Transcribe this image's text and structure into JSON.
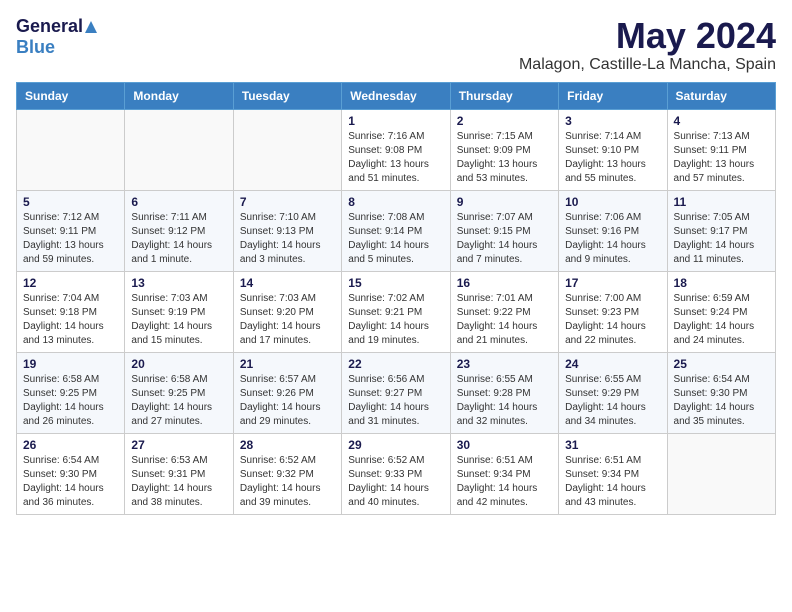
{
  "header": {
    "logo_general": "General",
    "logo_blue": "Blue",
    "month": "May 2024",
    "location": "Malagon, Castille-La Mancha, Spain"
  },
  "weekdays": [
    "Sunday",
    "Monday",
    "Tuesday",
    "Wednesday",
    "Thursday",
    "Friday",
    "Saturday"
  ],
  "weeks": [
    [
      {
        "day": "",
        "info": ""
      },
      {
        "day": "",
        "info": ""
      },
      {
        "day": "",
        "info": ""
      },
      {
        "day": "1",
        "info": "Sunrise: 7:16 AM\nSunset: 9:08 PM\nDaylight: 13 hours\nand 51 minutes."
      },
      {
        "day": "2",
        "info": "Sunrise: 7:15 AM\nSunset: 9:09 PM\nDaylight: 13 hours\nand 53 minutes."
      },
      {
        "day": "3",
        "info": "Sunrise: 7:14 AM\nSunset: 9:10 PM\nDaylight: 13 hours\nand 55 minutes."
      },
      {
        "day": "4",
        "info": "Sunrise: 7:13 AM\nSunset: 9:11 PM\nDaylight: 13 hours\nand 57 minutes."
      }
    ],
    [
      {
        "day": "5",
        "info": "Sunrise: 7:12 AM\nSunset: 9:11 PM\nDaylight: 13 hours\nand 59 minutes."
      },
      {
        "day": "6",
        "info": "Sunrise: 7:11 AM\nSunset: 9:12 PM\nDaylight: 14 hours\nand 1 minute."
      },
      {
        "day": "7",
        "info": "Sunrise: 7:10 AM\nSunset: 9:13 PM\nDaylight: 14 hours\nand 3 minutes."
      },
      {
        "day": "8",
        "info": "Sunrise: 7:08 AM\nSunset: 9:14 PM\nDaylight: 14 hours\nand 5 minutes."
      },
      {
        "day": "9",
        "info": "Sunrise: 7:07 AM\nSunset: 9:15 PM\nDaylight: 14 hours\nand 7 minutes."
      },
      {
        "day": "10",
        "info": "Sunrise: 7:06 AM\nSunset: 9:16 PM\nDaylight: 14 hours\nand 9 minutes."
      },
      {
        "day": "11",
        "info": "Sunrise: 7:05 AM\nSunset: 9:17 PM\nDaylight: 14 hours\nand 11 minutes."
      }
    ],
    [
      {
        "day": "12",
        "info": "Sunrise: 7:04 AM\nSunset: 9:18 PM\nDaylight: 14 hours\nand 13 minutes."
      },
      {
        "day": "13",
        "info": "Sunrise: 7:03 AM\nSunset: 9:19 PM\nDaylight: 14 hours\nand 15 minutes."
      },
      {
        "day": "14",
        "info": "Sunrise: 7:03 AM\nSunset: 9:20 PM\nDaylight: 14 hours\nand 17 minutes."
      },
      {
        "day": "15",
        "info": "Sunrise: 7:02 AM\nSunset: 9:21 PM\nDaylight: 14 hours\nand 19 minutes."
      },
      {
        "day": "16",
        "info": "Sunrise: 7:01 AM\nSunset: 9:22 PM\nDaylight: 14 hours\nand 21 minutes."
      },
      {
        "day": "17",
        "info": "Sunrise: 7:00 AM\nSunset: 9:23 PM\nDaylight: 14 hours\nand 22 minutes."
      },
      {
        "day": "18",
        "info": "Sunrise: 6:59 AM\nSunset: 9:24 PM\nDaylight: 14 hours\nand 24 minutes."
      }
    ],
    [
      {
        "day": "19",
        "info": "Sunrise: 6:58 AM\nSunset: 9:25 PM\nDaylight: 14 hours\nand 26 minutes."
      },
      {
        "day": "20",
        "info": "Sunrise: 6:58 AM\nSunset: 9:25 PM\nDaylight: 14 hours\nand 27 minutes."
      },
      {
        "day": "21",
        "info": "Sunrise: 6:57 AM\nSunset: 9:26 PM\nDaylight: 14 hours\nand 29 minutes."
      },
      {
        "day": "22",
        "info": "Sunrise: 6:56 AM\nSunset: 9:27 PM\nDaylight: 14 hours\nand 31 minutes."
      },
      {
        "day": "23",
        "info": "Sunrise: 6:55 AM\nSunset: 9:28 PM\nDaylight: 14 hours\nand 32 minutes."
      },
      {
        "day": "24",
        "info": "Sunrise: 6:55 AM\nSunset: 9:29 PM\nDaylight: 14 hours\nand 34 minutes."
      },
      {
        "day": "25",
        "info": "Sunrise: 6:54 AM\nSunset: 9:30 PM\nDaylight: 14 hours\nand 35 minutes."
      }
    ],
    [
      {
        "day": "26",
        "info": "Sunrise: 6:54 AM\nSunset: 9:30 PM\nDaylight: 14 hours\nand 36 minutes."
      },
      {
        "day": "27",
        "info": "Sunrise: 6:53 AM\nSunset: 9:31 PM\nDaylight: 14 hours\nand 38 minutes."
      },
      {
        "day": "28",
        "info": "Sunrise: 6:52 AM\nSunset: 9:32 PM\nDaylight: 14 hours\nand 39 minutes."
      },
      {
        "day": "29",
        "info": "Sunrise: 6:52 AM\nSunset: 9:33 PM\nDaylight: 14 hours\nand 40 minutes."
      },
      {
        "day": "30",
        "info": "Sunrise: 6:51 AM\nSunset: 9:34 PM\nDaylight: 14 hours\nand 42 minutes."
      },
      {
        "day": "31",
        "info": "Sunrise: 6:51 AM\nSunset: 9:34 PM\nDaylight: 14 hours\nand 43 minutes."
      },
      {
        "day": "",
        "info": ""
      }
    ]
  ]
}
